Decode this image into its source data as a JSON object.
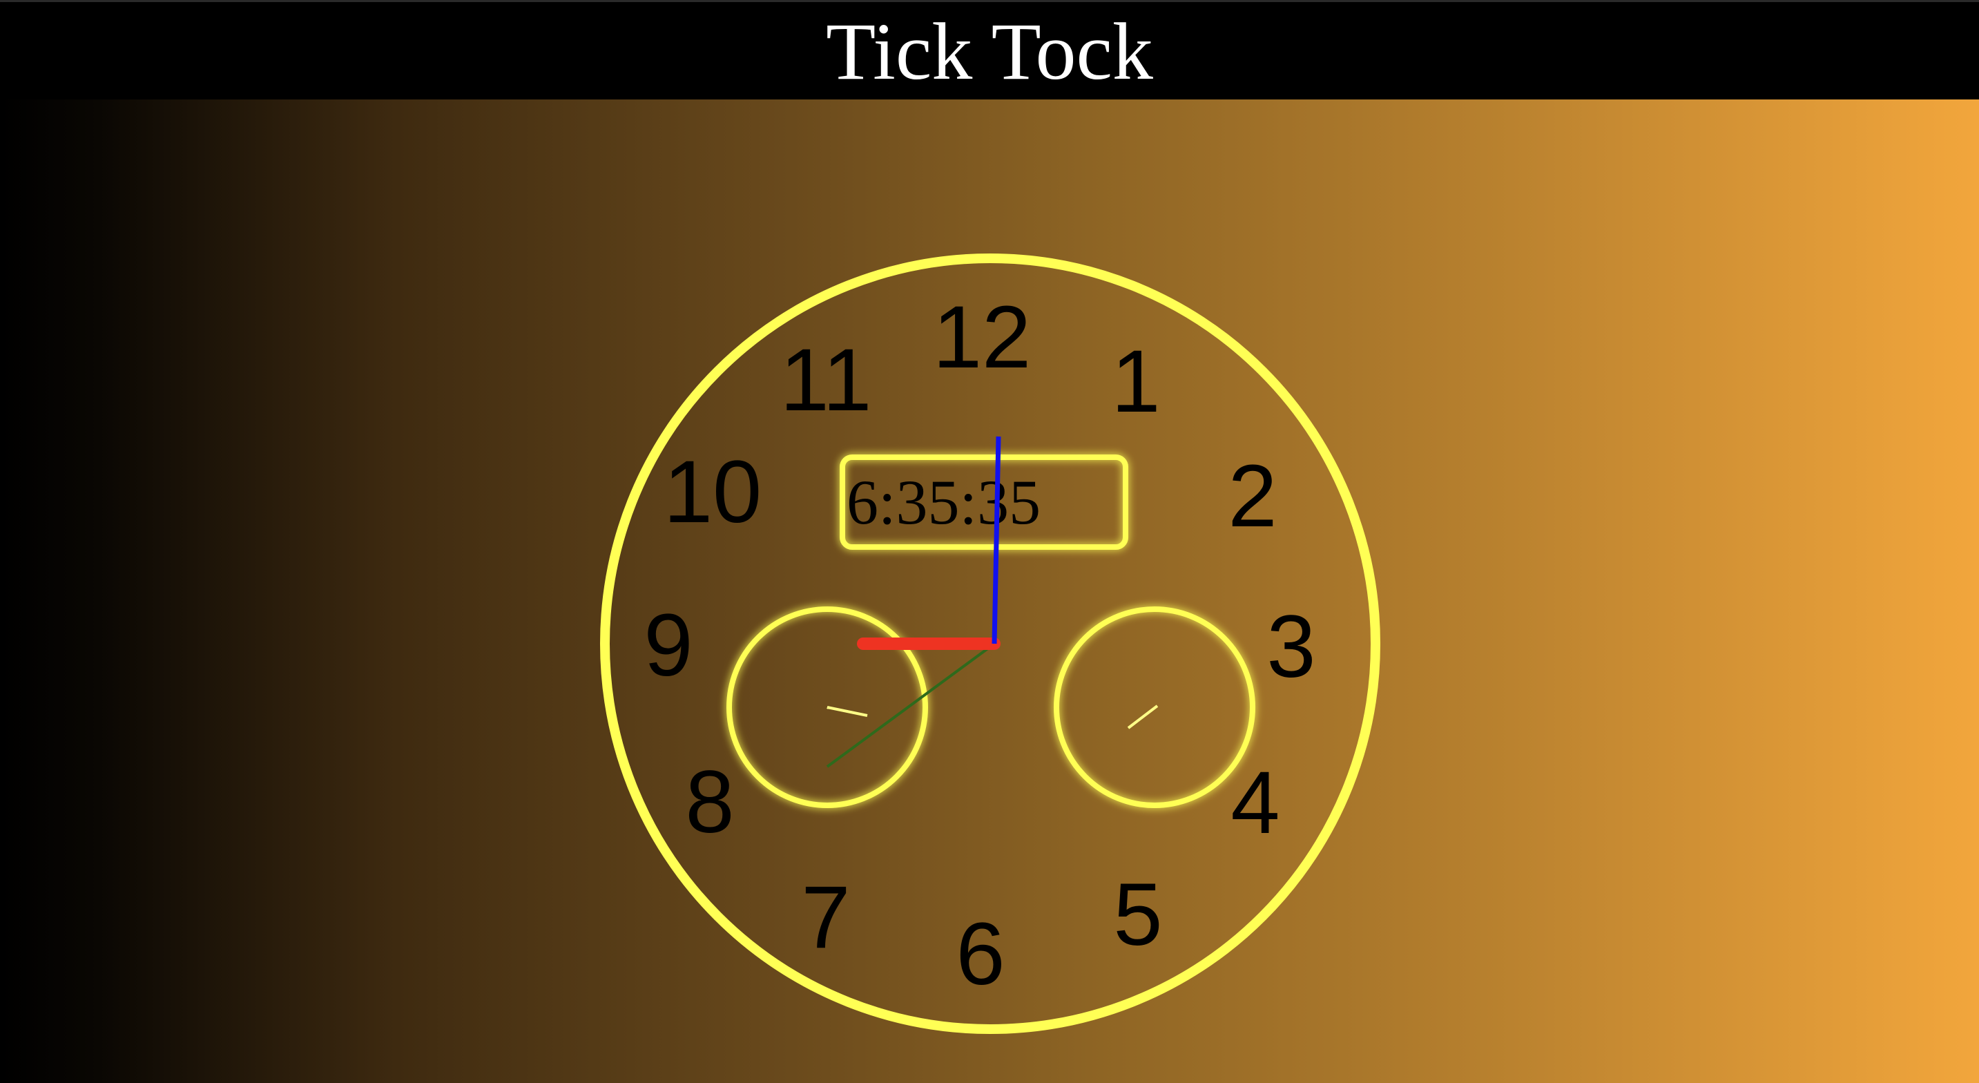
{
  "header": {
    "title": "Tick Tock"
  },
  "clock": {
    "digital_time": "6:35:35",
    "hour_numbers": [
      "12",
      "1",
      "2",
      "3",
      "4",
      "5",
      "6",
      "7",
      "8",
      "9",
      "10",
      "11"
    ],
    "colors": {
      "rim": "#ffff55",
      "hour_hand": "#ee3322",
      "minute_hand": "#1111ee",
      "second_hand": "#2e6a1c",
      "subdial_hand": "#ffff88"
    }
  }
}
